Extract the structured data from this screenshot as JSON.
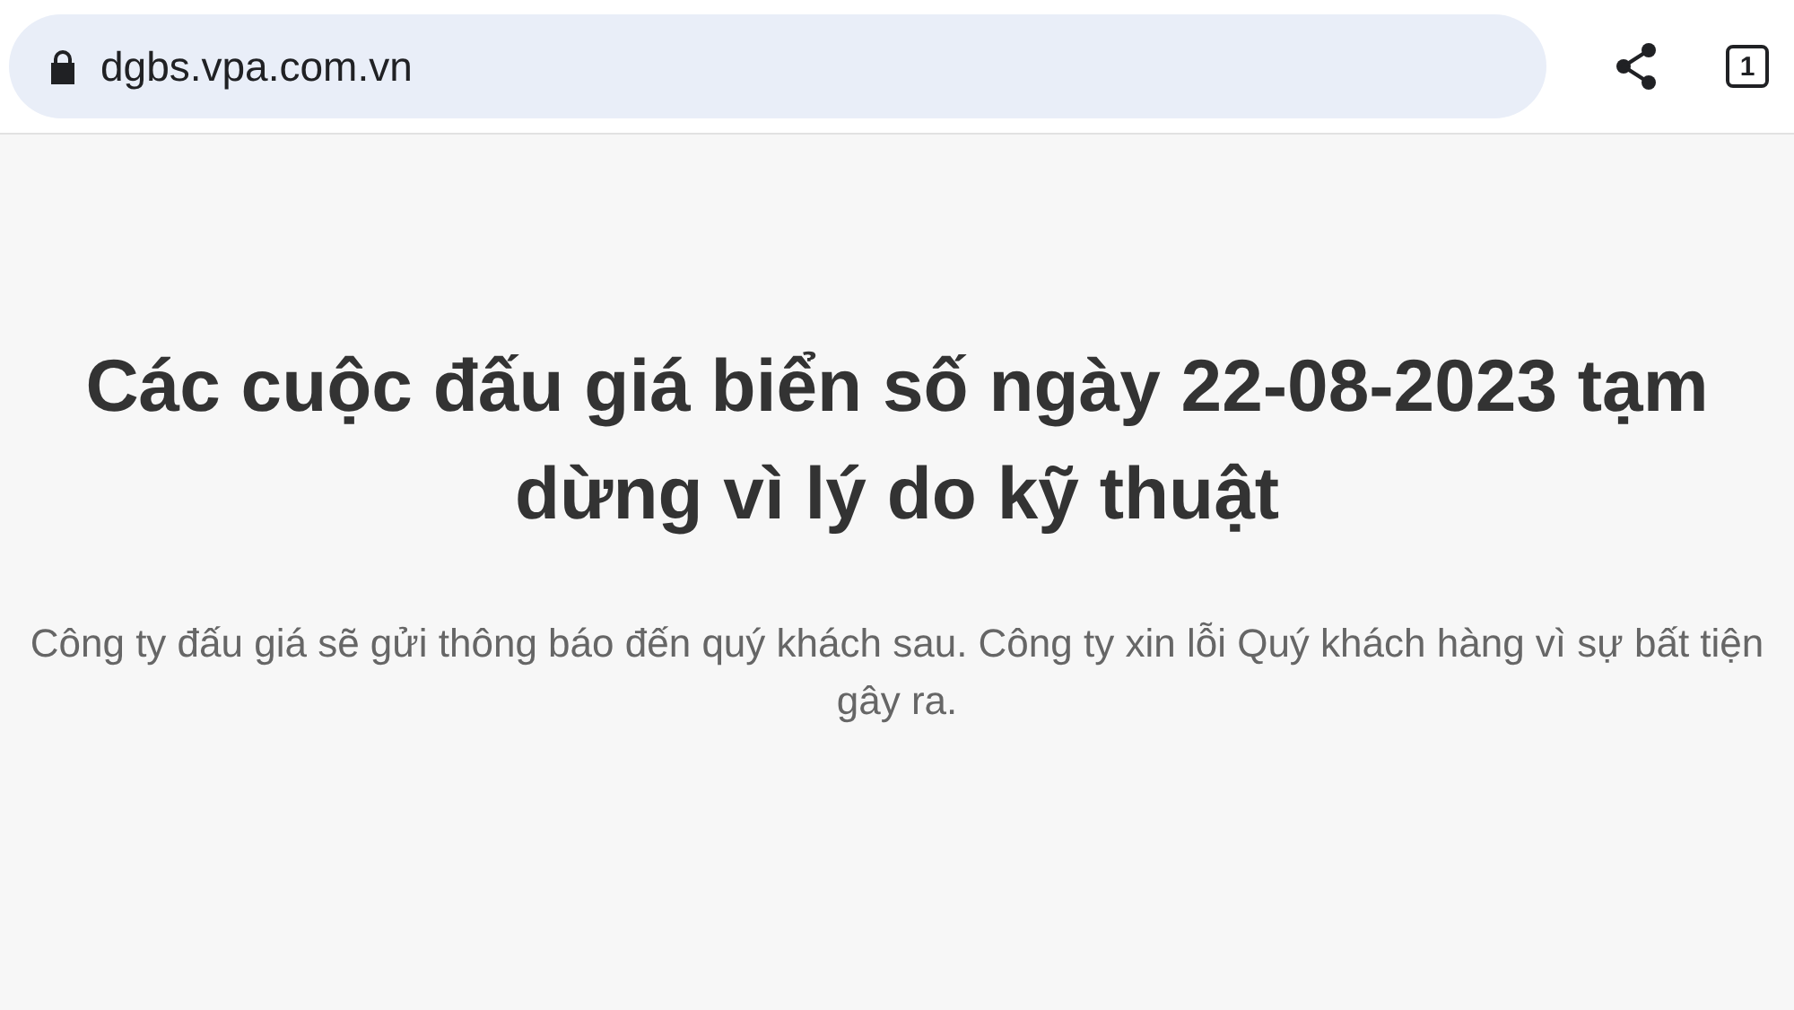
{
  "address_bar": {
    "url": "dgbs.vpa.com.vn"
  },
  "tab_count": "1",
  "heading": "Các cuộc đấu giá biển số ngày 22-08-2023 tạm dừng vì lý do kỹ thuật",
  "message": "Công ty đấu giá sẽ gửi thông báo đến quý khách sau. Công ty xin lỗi Quý khách hàng vì sự bất tiện gây ra."
}
